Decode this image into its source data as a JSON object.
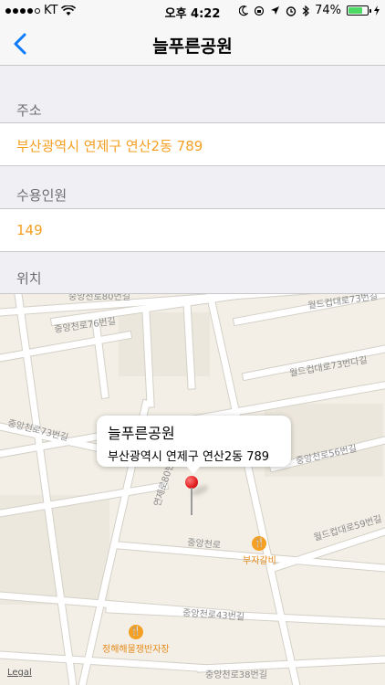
{
  "status_bar": {
    "carrier": "KT",
    "time": "오후 4:22",
    "battery_text": "74%",
    "battery_level": 0.74,
    "icons": [
      "signal-dots-icon",
      "wifi-icon",
      "moon-icon",
      "rotation-lock-icon",
      "location-arrow-icon",
      "alarm-icon",
      "bluetooth-icon",
      "battery-icon",
      "charging-bolt-icon"
    ]
  },
  "nav": {
    "title": "늘푸른공원",
    "back_icon": "chevron-left-icon"
  },
  "sections": {
    "address_header": "주소",
    "address_value": "부산광역시 연제구 연산2동 789",
    "capacity_header": "수용인원",
    "capacity_value": "149",
    "location_header": "위치"
  },
  "map": {
    "callout_title": "늘푸른공원",
    "callout_subtitle": "부산광역시 연제구 연산2동 789",
    "streets": [
      "중앙천로80번길",
      "중앙천로76번길",
      "월드컵대로73번길",
      "월드컵대로73번다길",
      "중앙천로73번길",
      "중앙천로56번길",
      "연제로80번",
      "중앙천로",
      "월드컵대로59번길",
      "중앙천로43번길",
      "중앙천로38번길"
    ],
    "pois": [
      {
        "name": "부자갈비",
        "icon": "restaurant-icon"
      },
      {
        "name": "정해해물쟁반자장",
        "icon": "restaurant-icon"
      }
    ],
    "legal": "Legal",
    "accent_color": "#f5a023",
    "pin_color": "#e01e1e"
  }
}
